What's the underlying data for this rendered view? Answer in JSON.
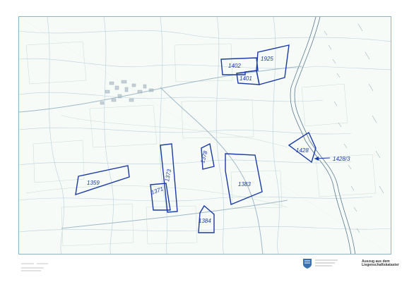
{
  "map": {
    "parcel_numbers": [
      "1402",
      "1925",
      "1401",
      "1428",
      "1428/3",
      "1359",
      "1373",
      "1371",
      "1378",
      "1383",
      "1384"
    ],
    "colors": {
      "parcel_outline": "#1a3aa6",
      "base_lines": "#b9cfdc",
      "field_lines": "#c9dccf",
      "river": "#5c7a8e",
      "paper": "#ffffff",
      "map_bg": "#f7fbf8"
    }
  },
  "footer": {
    "title_line1": "Auszug aus dem",
    "title_line2": "Liegenschaftskataster"
  }
}
